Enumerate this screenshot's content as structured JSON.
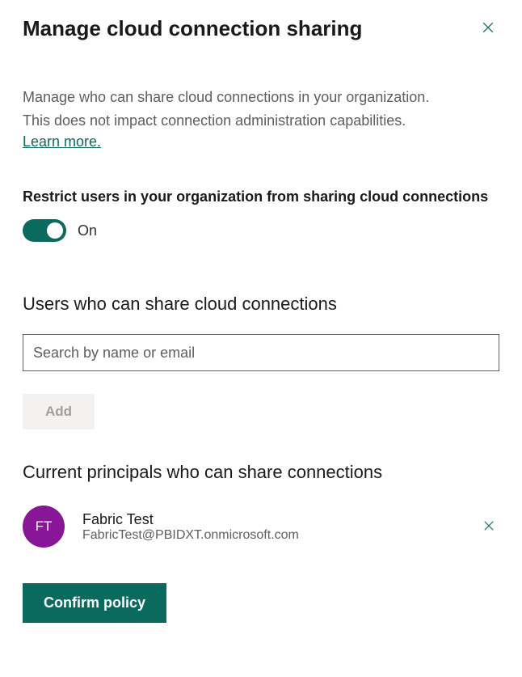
{
  "header": {
    "title": "Manage cloud connection sharing"
  },
  "description": {
    "line1": "Manage who can share cloud connections in your organization.",
    "line2": "This does not impact connection administration capabilities.",
    "learn_more": "Learn more."
  },
  "restrict": {
    "label": "Restrict users in your organization from sharing cloud connections",
    "state_text": "On"
  },
  "users_section": {
    "title": "Users who can share cloud connections",
    "search_placeholder": "Search by name or email",
    "add_label": "Add"
  },
  "principals_section": {
    "title": "Current principals who can share connections",
    "items": [
      {
        "initials": "FT",
        "name": "Fabric Test",
        "email": "FabricTest@PBIDXT.onmicrosoft.com"
      }
    ]
  },
  "footer": {
    "confirm_label": "Confirm policy"
  }
}
